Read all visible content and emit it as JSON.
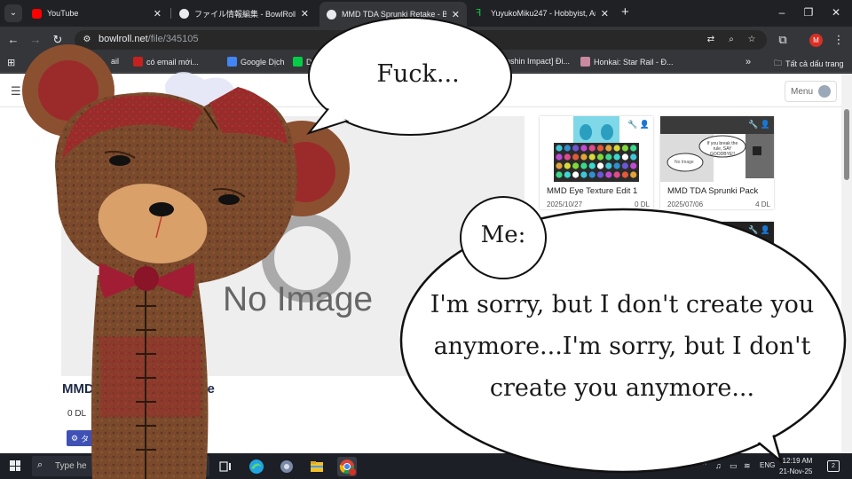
{
  "tabs": [
    {
      "title": "YouTube",
      "favicon": "youtube-icon",
      "active": false
    },
    {
      "title": "ファイル情報編集 - BowlRoll",
      "favicon": "bowlroll-icon",
      "active": false
    },
    {
      "title": "MMD TDA Sprunki Retake - BowlRoll",
      "favicon": "bowlroll-icon",
      "active": true
    },
    {
      "title": "YuyukoMiku247 - Hobbyist, Artist",
      "favicon": "deviantart-icon",
      "active": false
    }
  ],
  "omnibox": {
    "host": "bowlroll.net",
    "path": "/file/345105"
  },
  "bookmarks": {
    "items": [
      {
        "label": "ail"
      },
      {
        "label": "có email mới..."
      },
      {
        "label": "Google Dịch"
      },
      {
        "label": "D"
      },
      {
        "label": "enshin Impact] Đi..."
      },
      {
        "label": "Honkai: Star Rail - Đ..."
      }
    ],
    "more": "»",
    "all_bookmarks": "Tất cả dấu trang"
  },
  "site": {
    "menu_label": "Menu",
    "no_image": "No Image",
    "file_title_prefix": "MMD",
    "file_title_suffix": "ake",
    "downloads": "0 DL",
    "tag_button": "タ"
  },
  "cards": [
    {
      "title": "MMD Eye Texture Edit 1",
      "date": "2025/10/27",
      "downloads": "0 DL"
    },
    {
      "title": "MMD TDA Sprunki Pack",
      "date": "2025/07/06",
      "downloads": "4 DL",
      "thumb_text_1": "If you break the rule, SAY GOODBYE!!",
      "thumb_text_2": "No Image"
    }
  ],
  "taskbar": {
    "search_placeholder": "Type he",
    "language": "ENG",
    "time": "12:19 AM",
    "date": "21-Nov-25",
    "notification_count": "2"
  },
  "meme": {
    "bubble_top": "Fuck...",
    "speaker": "Me:",
    "bubble_bottom": "I'm sorry, but I don't create you anymore...I'm sorry, but I don't create you anymore..."
  },
  "colors": {
    "bear_body": "#7a4a2c",
    "bear_muzzle": "#d9a06a",
    "bear_red": "#9b2b2b",
    "bow": "#a11d33",
    "tag_button": "#3f51b5",
    "avatar": "#d93025"
  }
}
